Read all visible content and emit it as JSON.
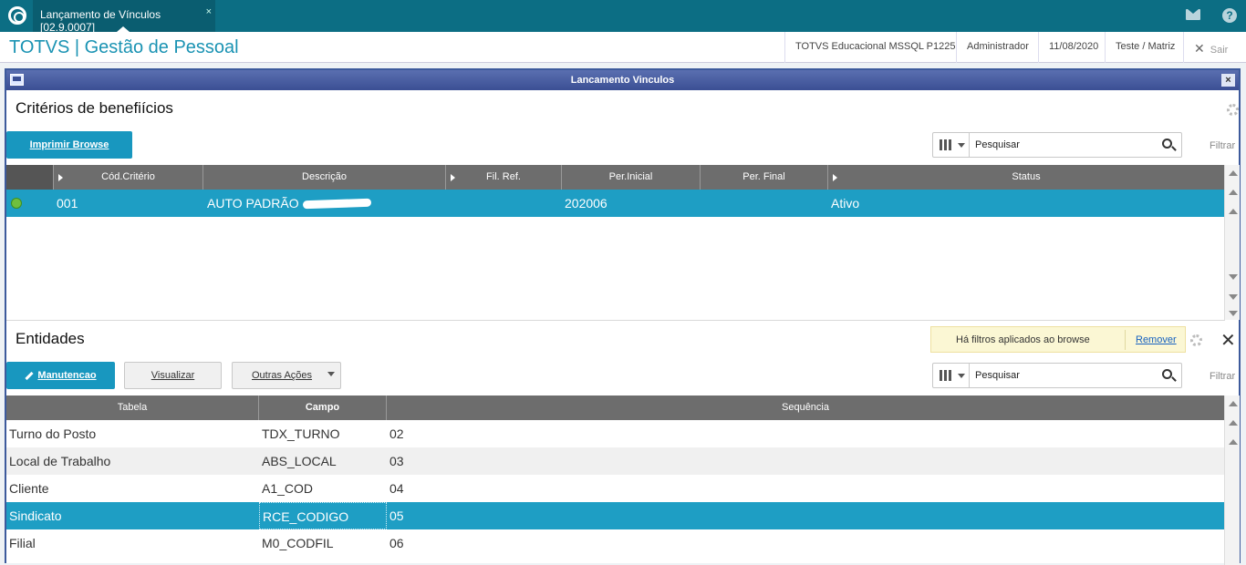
{
  "topbar": {
    "tab_label": "Lançamento de Vínculos [02.9.0007]",
    "tab_close": "×",
    "help": "?"
  },
  "header": {
    "app_title": "TOTVS | Gestão de Pessoal",
    "environment": "TOTVS Educacional MSSQL P1225",
    "user": "Administrador",
    "date": "11/08/2020",
    "branch": "Teste / Matriz",
    "logout": "Sair"
  },
  "window": {
    "title": "Lancamento Vinculos",
    "close": "×"
  },
  "criterios": {
    "title": "Critérios de benefiícios",
    "print_button": "Imprimir Browse",
    "search_placeholder": "Pesquisar",
    "filter": "Filtrar",
    "columns": [
      "Cód.Critério",
      "Descrição",
      "Fil. Ref.",
      "Per.Inicial",
      "Per. Final",
      "Status"
    ],
    "rows": [
      {
        "codigo": "001",
        "descricao": "AUTO PADRÃO",
        "fil_ref": "",
        "per_inicial": "202006",
        "per_final": "",
        "status": "Ativo"
      }
    ]
  },
  "entidades": {
    "title": "Entidades",
    "notice_text": "Há filtros aplicados ao browse",
    "notice_link": "Remover",
    "close": "✕",
    "buttons": {
      "manutencao": "Manutencao",
      "visualizar": "Visualizar",
      "outras": "Outras Ações"
    },
    "search_placeholder": "Pesquisar",
    "filter": "Filtrar",
    "columns": [
      "Tabela",
      "Campo",
      "Sequência"
    ],
    "rows": [
      {
        "tabela": "Turno do Posto",
        "campo": "TDX_TURNO",
        "sequencia": "02"
      },
      {
        "tabela": "Local de Trabalho",
        "campo": "ABS_LOCAL",
        "sequencia": "03"
      },
      {
        "tabela": "Cliente",
        "campo": "A1_COD",
        "sequencia": "04"
      },
      {
        "tabela": "Sindicato",
        "campo": "RCE_CODIGO",
        "sequencia": "05"
      },
      {
        "tabela": "Filial",
        "campo": "M0_CODFIL",
        "sequencia": "06"
      }
    ],
    "selected_row": 3
  },
  "colors": {
    "topbar": "#0c6e84",
    "accent": "#1897bf",
    "selected_row": "#1e9ec4",
    "window_title": "#3b4f94"
  }
}
